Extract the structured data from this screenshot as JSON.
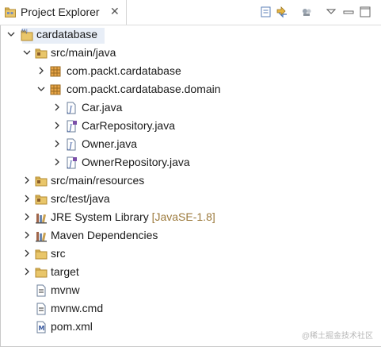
{
  "tab": {
    "title": "Project Explorer",
    "close": "✕"
  },
  "toolbar": {
    "collapse_icon": "collapse-all-icon",
    "link_icon": "link-with-editor-icon",
    "filter_icon": "filter-icon",
    "menu_icon": "view-menu-icon",
    "minimize_icon": "minimize-icon",
    "maximize_icon": "maximize-icon"
  },
  "tree": [
    {
      "label": "cardatabase",
      "icon": "maven-project-icon"
    },
    {
      "label": "src/main/java",
      "icon": "source-folder-icon"
    },
    {
      "label": "com.packt.cardatabase",
      "icon": "package-icon"
    },
    {
      "label": "com.packt.cardatabase.domain",
      "icon": "package-icon"
    },
    {
      "label": "Car.java",
      "icon": "java-class-icon"
    },
    {
      "label": "CarRepository.java",
      "icon": "java-interface-icon"
    },
    {
      "label": "Owner.java",
      "icon": "java-class-icon"
    },
    {
      "label": "OwnerRepository.java",
      "icon": "java-interface-icon"
    },
    {
      "label": "src/main/resources",
      "icon": "source-folder-icon"
    },
    {
      "label": "src/test/java",
      "icon": "source-folder-icon"
    },
    {
      "label": "JRE System Library",
      "suffix": "[JavaSE-1.8]",
      "icon": "library-icon"
    },
    {
      "label": "Maven Dependencies",
      "icon": "library-icon"
    },
    {
      "label": "src",
      "icon": "folder-icon"
    },
    {
      "label": "target",
      "icon": "folder-icon"
    },
    {
      "label": "mvnw",
      "icon": "file-icon"
    },
    {
      "label": "mvnw.cmd",
      "icon": "file-icon"
    },
    {
      "label": "pom.xml",
      "icon": "maven-pom-icon"
    }
  ],
  "watermark": "@稀土掘金技术社区",
  "colors": {
    "selection": "#e8eef7",
    "version": "#9c7a3c"
  }
}
